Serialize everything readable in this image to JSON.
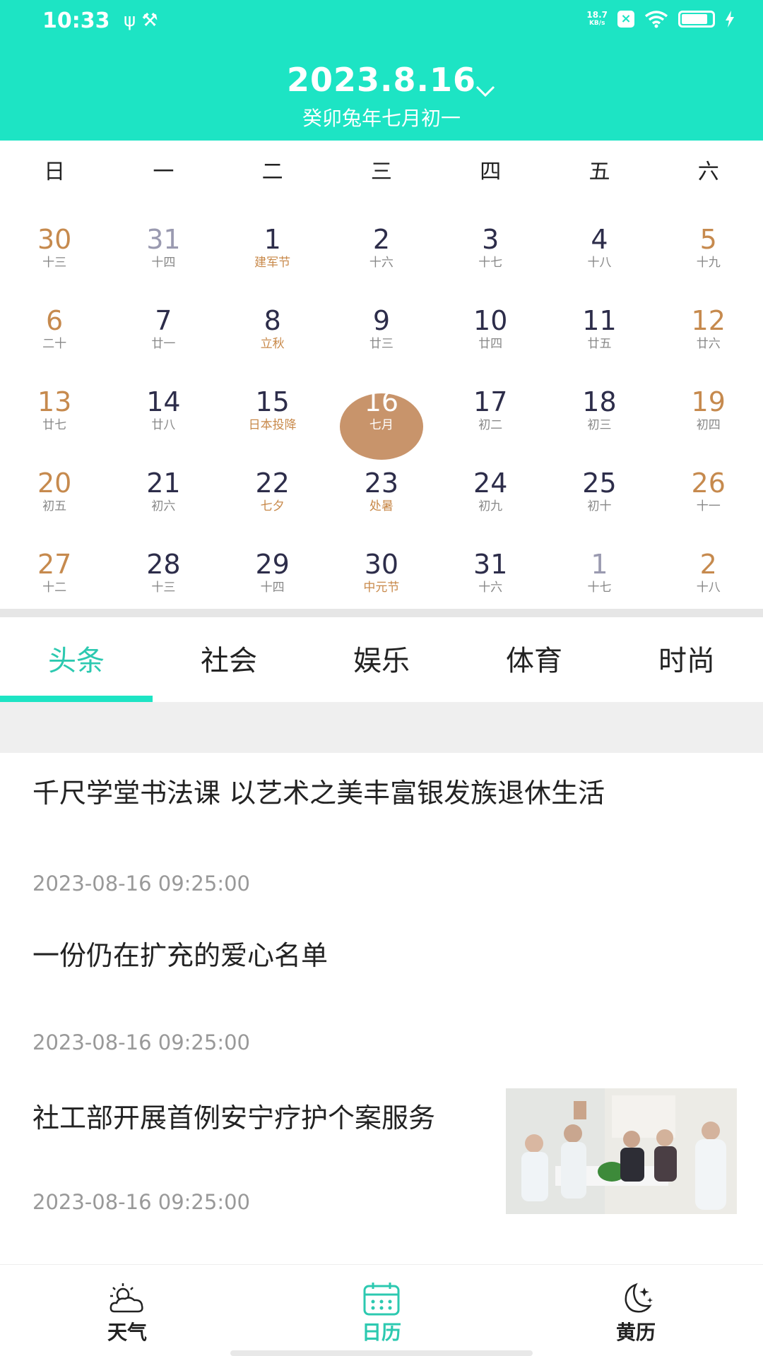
{
  "status_bar": {
    "time": "10:33",
    "left_icons": "ψ ⚒",
    "net_speed_value": "18.7",
    "net_speed_unit": "KB/s"
  },
  "header": {
    "date": "2023.8.16",
    "lunar": "癸卯兔年七月初一"
  },
  "weekdays": [
    "日",
    "一",
    "二",
    "三",
    "四",
    "五",
    "六"
  ],
  "calendar": {
    "weeks": [
      [
        {
          "d": "30",
          "s": "十三"
        },
        {
          "d": "31",
          "s": "十四"
        },
        {
          "d": "1",
          "s": "建军节"
        },
        {
          "d": "2",
          "s": "十六"
        },
        {
          "d": "3",
          "s": "十七"
        },
        {
          "d": "4",
          "s": "十八"
        },
        {
          "d": "5",
          "s": "十九"
        }
      ],
      [
        {
          "d": "6",
          "s": "二十"
        },
        {
          "d": "7",
          "s": "廿一"
        },
        {
          "d": "8",
          "s": "立秋"
        },
        {
          "d": "9",
          "s": "廿三"
        },
        {
          "d": "10",
          "s": "廿四"
        },
        {
          "d": "11",
          "s": "廿五"
        },
        {
          "d": "12",
          "s": "廿六"
        }
      ],
      [
        {
          "d": "13",
          "s": "廿七"
        },
        {
          "d": "14",
          "s": "廿八"
        },
        {
          "d": "15",
          "s": "日本投降"
        },
        {
          "d": "16",
          "s": "七月"
        },
        {
          "d": "17",
          "s": "初二"
        },
        {
          "d": "18",
          "s": "初三"
        },
        {
          "d": "19",
          "s": "初四"
        }
      ],
      [
        {
          "d": "20",
          "s": "初五"
        },
        {
          "d": "21",
          "s": "初六"
        },
        {
          "d": "22",
          "s": "七夕"
        },
        {
          "d": "23",
          "s": "处暑"
        },
        {
          "d": "24",
          "s": "初九"
        },
        {
          "d": "25",
          "s": "初十"
        },
        {
          "d": "26",
          "s": "十一"
        }
      ],
      [
        {
          "d": "27",
          "s": "十二"
        },
        {
          "d": "28",
          "s": "十三"
        },
        {
          "d": "29",
          "s": "十四"
        },
        {
          "d": "30",
          "s": "中元节"
        },
        {
          "d": "31",
          "s": "十六"
        },
        {
          "d": "1",
          "s": "十七"
        },
        {
          "d": "2",
          "s": "十八"
        }
      ]
    ]
  },
  "tabs": [
    "头条",
    "社会",
    "娱乐",
    "体育",
    "时尚"
  ],
  "news": [
    {
      "title": "千尺学堂书法课 以艺术之美丰富银发族退休生活",
      "time": "2023-08-16 09:25:00"
    },
    {
      "title": "一份仍在扩充的爱心名单",
      "time": "2023-08-16 09:25:00"
    },
    {
      "title": "社工部开展首例安宁疗护个案服务",
      "time": "2023-08-16 09:25:00"
    }
  ],
  "bottom_nav": [
    {
      "label": "天气",
      "icon": "weather-icon"
    },
    {
      "label": "日历",
      "icon": "calendar-icon"
    },
    {
      "label": "黄历",
      "icon": "moon-icon"
    }
  ],
  "colors": {
    "accent": "#1de4c4",
    "active_text": "#2cc9b0",
    "weekend": "#c68a4e",
    "today": "#c8946b"
  }
}
